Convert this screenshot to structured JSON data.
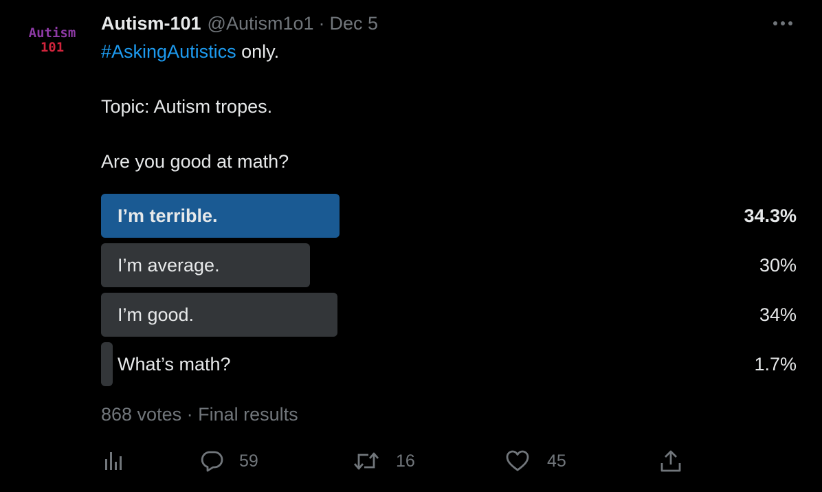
{
  "avatar": {
    "line1": "Autism",
    "line2": "101"
  },
  "author": {
    "display_name": "Autism-101",
    "handle": "@Autism1o1",
    "separator": "·",
    "date": "Dec 5"
  },
  "more_icon": "more-horizontal-icon",
  "tweet": {
    "hashtag": "#AskingAutistics",
    "line1_rest": " only.",
    "line2": "Topic: Autism tropes.",
    "line3": "Are you good at math?"
  },
  "poll": {
    "options": [
      {
        "label": "I’m terrible.",
        "percent_text": "34.3%",
        "percent": 34.3,
        "winner": true
      },
      {
        "label": "I’m average.",
        "percent_text": "30%",
        "percent": 30,
        "winner": false
      },
      {
        "label": "I’m good.",
        "percent_text": "34%",
        "percent": 34,
        "winner": false
      },
      {
        "label": "What’s math?",
        "percent_text": "1.7%",
        "percent": 1.7,
        "winner": false
      }
    ],
    "summary": "868 votes · Final results"
  },
  "actions": {
    "views_icon": "analytics-icon",
    "reply": {
      "icon": "reply-icon",
      "count": "59"
    },
    "retweet": {
      "icon": "retweet-icon",
      "count": "16"
    },
    "like": {
      "icon": "heart-icon",
      "count": "45"
    },
    "share_icon": "share-icon"
  },
  "colors": {
    "background": "#000000",
    "text": "#e7e9ea",
    "secondary": "#71767b",
    "link": "#1d9bf0",
    "winner_bar": "#1a5a93",
    "bar": "#333639",
    "avatar_purple": "#8e3aa6",
    "avatar_red": "#d1243c"
  }
}
